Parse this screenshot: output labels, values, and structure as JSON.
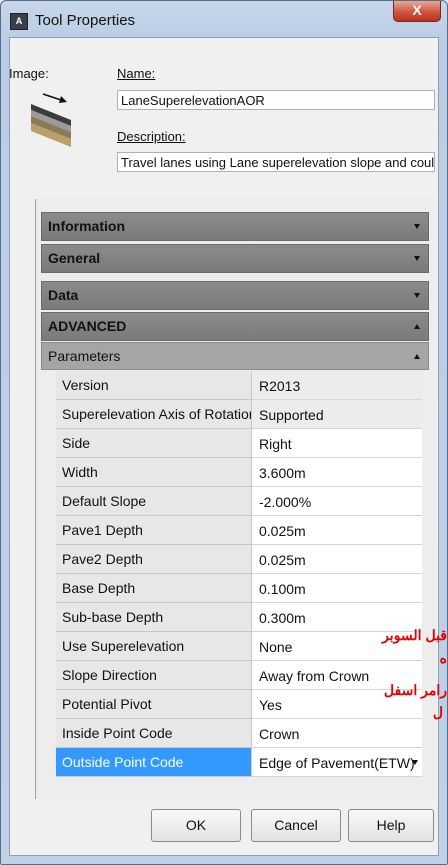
{
  "window": {
    "title": "Tool Properties",
    "close_glyph": "X",
    "app_icon_text": "A"
  },
  "image_label": "Image:",
  "name": {
    "label": "Name:",
    "value": "LaneSuperelevationAOR"
  },
  "description": {
    "label": "Description:",
    "value": "Travel lanes using Lane superelevation slope and could sup"
  },
  "sections": [
    {
      "label": "Information",
      "expanded": false
    },
    {
      "label": "General",
      "expanded": false
    },
    {
      "label": "Data",
      "expanded": false
    },
    {
      "label": "ADVANCED",
      "expanded": true
    }
  ],
  "parameters_label": "Parameters",
  "parameters": [
    {
      "name": "Version",
      "value": "R2013"
    },
    {
      "name": "Superelevation Axis of Rotation",
      "value": "Supported"
    },
    {
      "name": "Side",
      "value": "Right"
    },
    {
      "name": "Width",
      "value": "3.600m"
    },
    {
      "name": "Default Slope",
      "value": "-2.000%"
    },
    {
      "name": "Pave1 Depth",
      "value": "0.025m"
    },
    {
      "name": "Pave2 Depth",
      "value": "0.025m"
    },
    {
      "name": "Base Depth",
      "value": "0.100m"
    },
    {
      "name": "Sub-base Depth",
      "value": "0.300m"
    },
    {
      "name": "Use Superelevation",
      "value": "None"
    },
    {
      "name": "Slope Direction",
      "value": "Away from Crown"
    },
    {
      "name": "Potential Pivot",
      "value": "Yes"
    },
    {
      "name": "Inside Point Code",
      "value": "Crown"
    },
    {
      "name": "Outside Point Code",
      "value": "Edge of Pavement(ETW)"
    }
  ],
  "overlay_text": [
    "قبل السوبر",
    "ه",
    "رامر اسفل",
    "ل"
  ],
  "buttons": {
    "ok": "OK",
    "cancel": "Cancel",
    "help": "Help"
  },
  "colors": {
    "selection": "#3399ff",
    "overlay_text": "#e20000",
    "section_header": "#808080"
  }
}
